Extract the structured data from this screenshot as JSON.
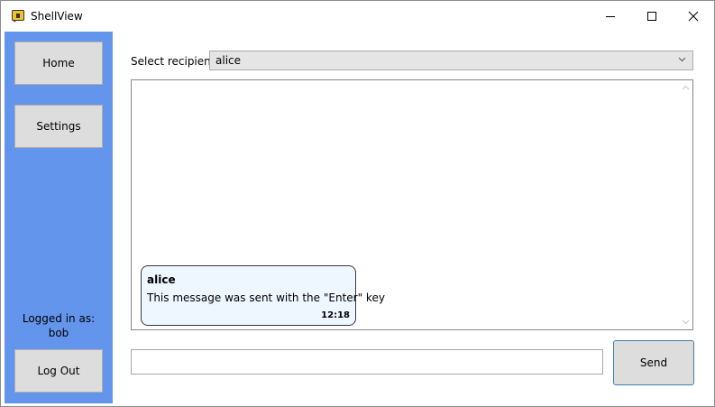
{
  "window": {
    "title": "ShellView"
  },
  "sidebar": {
    "home_label": "Home",
    "settings_label": "Settings",
    "logged_in_label": "Logged in as:",
    "username": "bob",
    "logout_label": "Log Out",
    "background_color": "#6495ed"
  },
  "chat": {
    "recipient_label": "Select recipient:",
    "recipient_value": "alice",
    "messages": [
      {
        "sender": "alice",
        "text": "This message was sent with the \"Enter\" key",
        "time": "12:18"
      }
    ],
    "input_value": "",
    "send_label": "Send"
  },
  "icons": {
    "app": "shell-app-icon",
    "minimize": "minimize-icon",
    "maximize": "maximize-icon",
    "close": "close-icon",
    "dropdown": "chevron-down-icon"
  }
}
